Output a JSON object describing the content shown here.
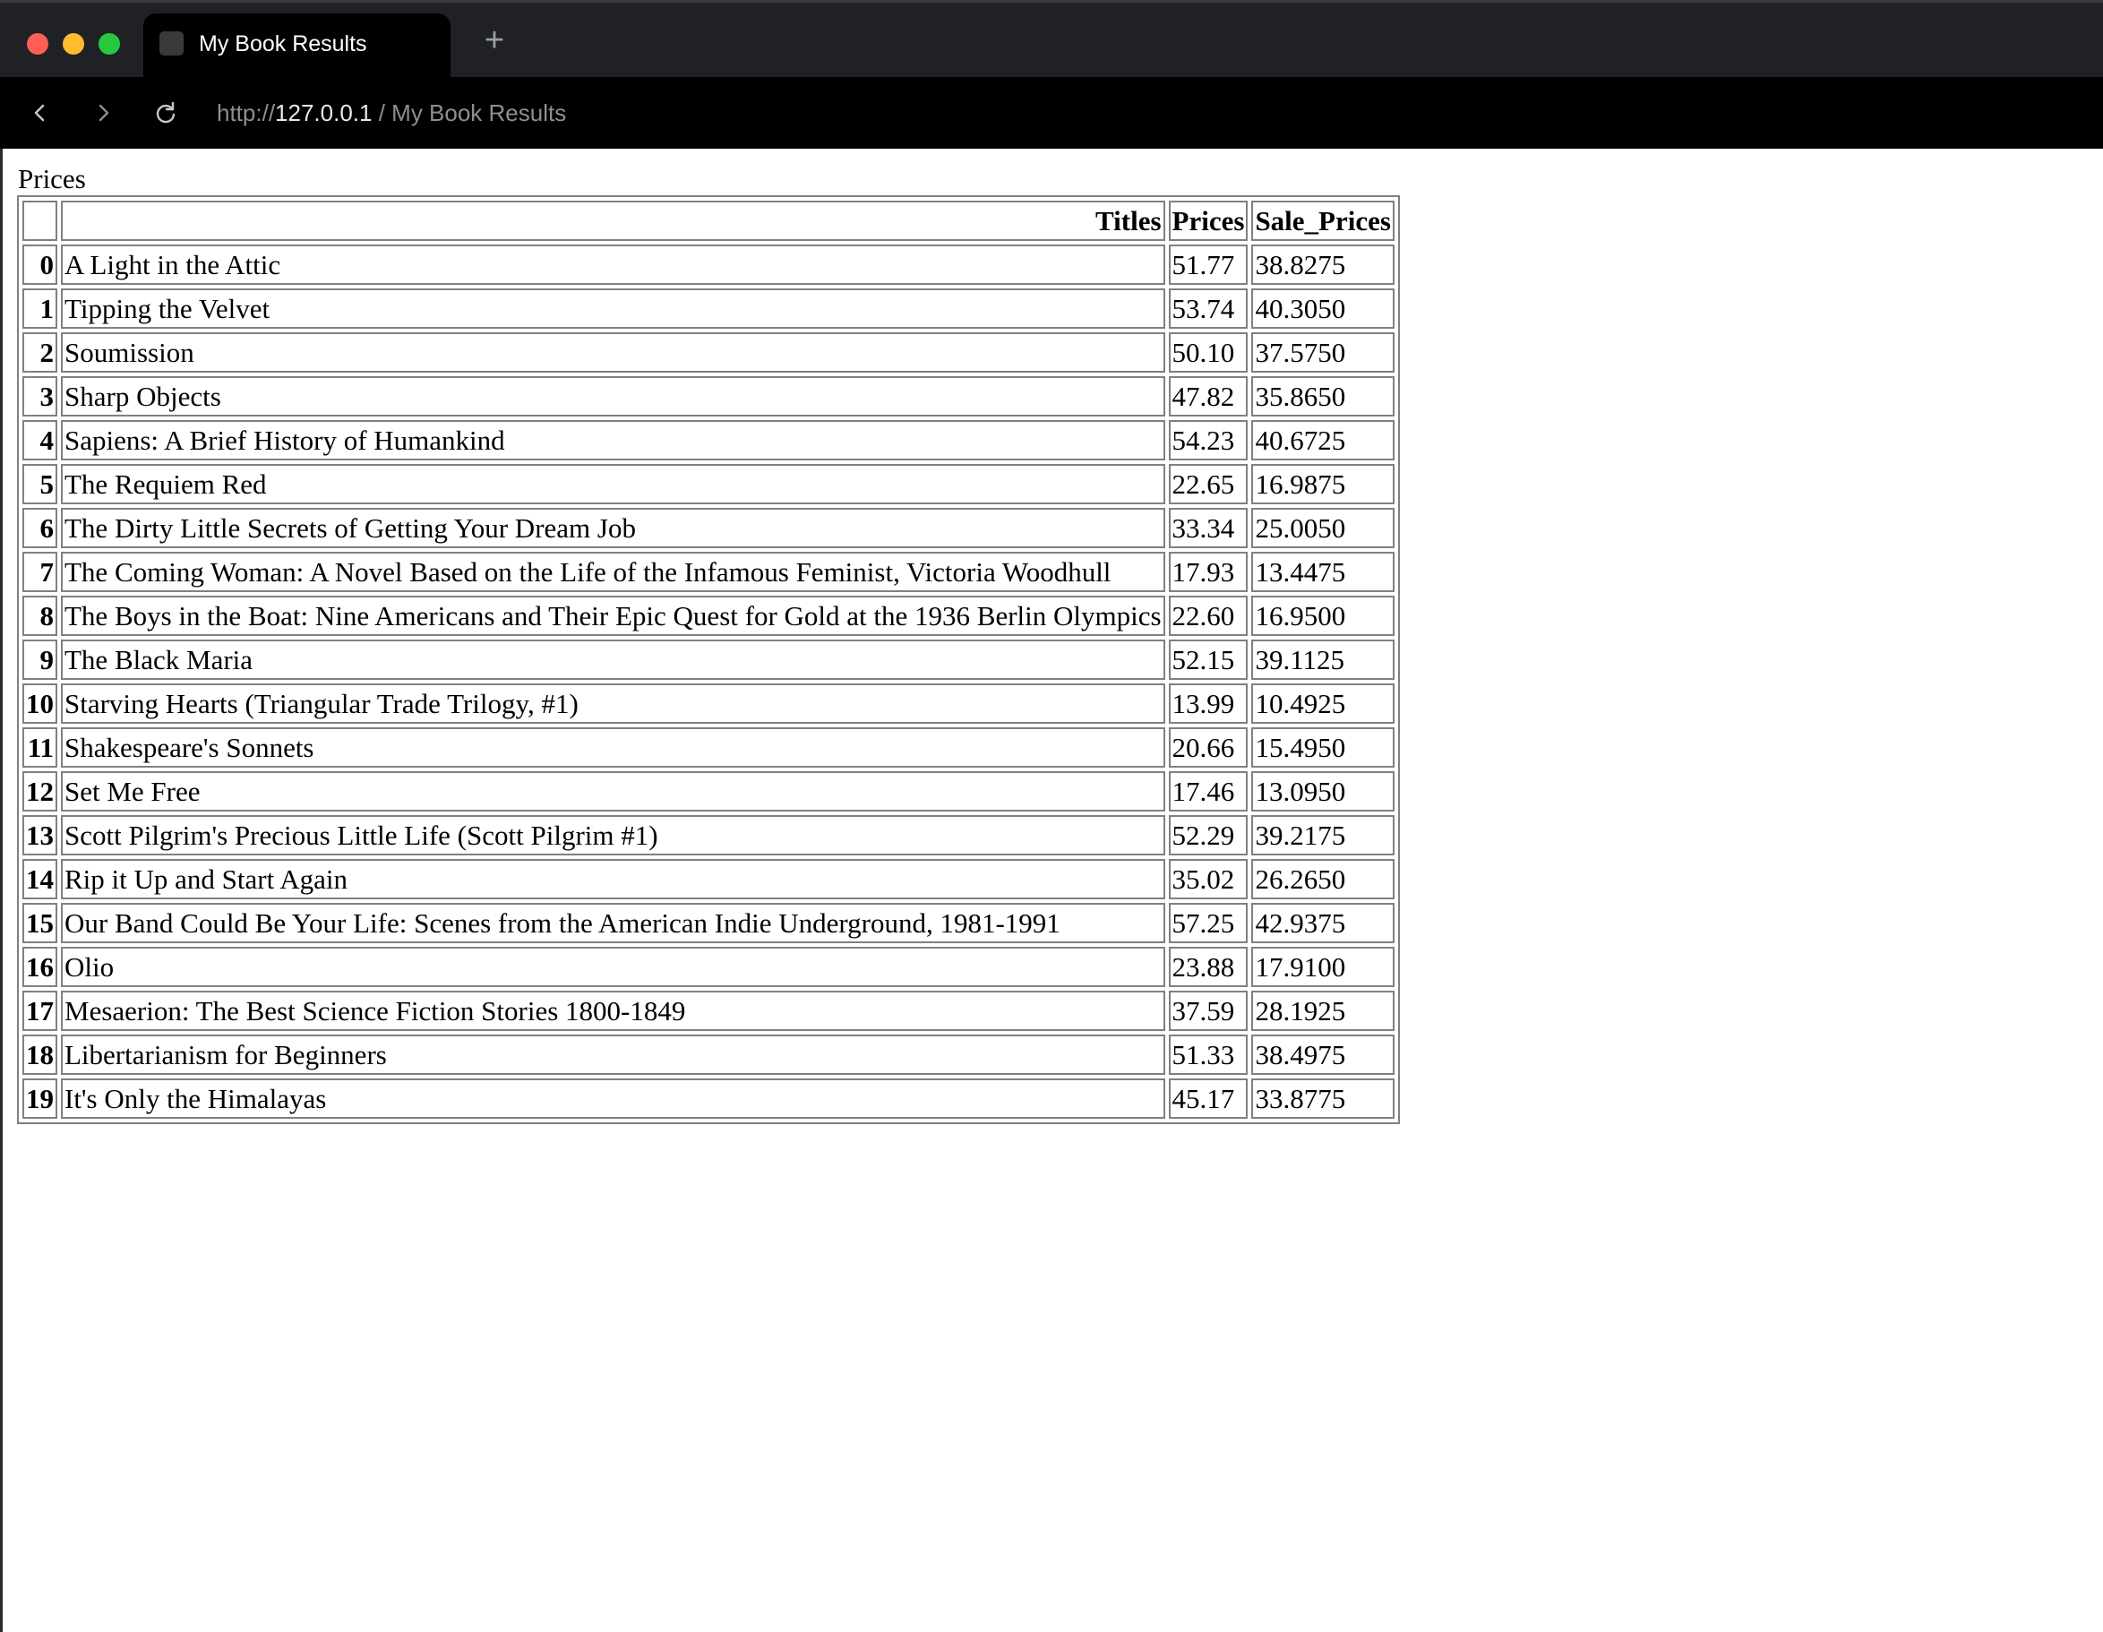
{
  "browser": {
    "tab_title": "My Book Results",
    "new_tab_symbol": "+",
    "address": {
      "scheme": "http://",
      "host": "127.0.0.1",
      "separator": " / ",
      "page_title": "My Book Results"
    },
    "icons": [
      "back-icon",
      "forward-icon",
      "reload-icon",
      "favicon-icon"
    ]
  },
  "page": {
    "caption": "Prices",
    "table": {
      "columns": [
        "",
        "Titles",
        "Prices",
        "Sale_Prices"
      ],
      "rows": [
        {
          "index": "0",
          "title": "A Light in the Attic",
          "price": "51.77",
          "sale": "38.8275"
        },
        {
          "index": "1",
          "title": "Tipping the Velvet",
          "price": "53.74",
          "sale": "40.3050"
        },
        {
          "index": "2",
          "title": "Soumission",
          "price": "50.10",
          "sale": "37.5750"
        },
        {
          "index": "3",
          "title": "Sharp Objects",
          "price": "47.82",
          "sale": "35.8650"
        },
        {
          "index": "4",
          "title": "Sapiens: A Brief History of Humankind",
          "price": "54.23",
          "sale": "40.6725"
        },
        {
          "index": "5",
          "title": "The Requiem Red",
          "price": "22.65",
          "sale": "16.9875"
        },
        {
          "index": "6",
          "title": "The Dirty Little Secrets of Getting Your Dream Job",
          "price": "33.34",
          "sale": "25.0050"
        },
        {
          "index": "7",
          "title": "The Coming Woman: A Novel Based on the Life of the Infamous Feminist, Victoria Woodhull",
          "price": "17.93",
          "sale": "13.4475"
        },
        {
          "index": "8",
          "title": "The Boys in the Boat: Nine Americans and Their Epic Quest for Gold at the 1936 Berlin Olympics",
          "price": "22.60",
          "sale": "16.9500"
        },
        {
          "index": "9",
          "title": "The Black Maria",
          "price": "52.15",
          "sale": "39.1125"
        },
        {
          "index": "10",
          "title": "Starving Hearts (Triangular Trade Trilogy, #1)",
          "price": "13.99",
          "sale": "10.4925"
        },
        {
          "index": "11",
          "title": "Shakespeare's Sonnets",
          "price": "20.66",
          "sale": "15.4950"
        },
        {
          "index": "12",
          "title": "Set Me Free",
          "price": "17.46",
          "sale": "13.0950"
        },
        {
          "index": "13",
          "title": "Scott Pilgrim's Precious Little Life (Scott Pilgrim #1)",
          "price": "52.29",
          "sale": "39.2175"
        },
        {
          "index": "14",
          "title": "Rip it Up and Start Again",
          "price": "35.02",
          "sale": "26.2650"
        },
        {
          "index": "15",
          "title": "Our Band Could Be Your Life: Scenes from the American Indie Underground, 1981-1991",
          "price": "57.25",
          "sale": "42.9375"
        },
        {
          "index": "16",
          "title": "Olio",
          "price": "23.88",
          "sale": "17.9100"
        },
        {
          "index": "17",
          "title": "Mesaerion: The Best Science Fiction Stories 1800-1849",
          "price": "37.59",
          "sale": "28.1925"
        },
        {
          "index": "18",
          "title": "Libertarianism for Beginners",
          "price": "51.33",
          "sale": "38.4975"
        },
        {
          "index": "19",
          "title": "It's Only the Himalayas",
          "price": "45.17",
          "sale": "33.8775"
        }
      ]
    }
  }
}
